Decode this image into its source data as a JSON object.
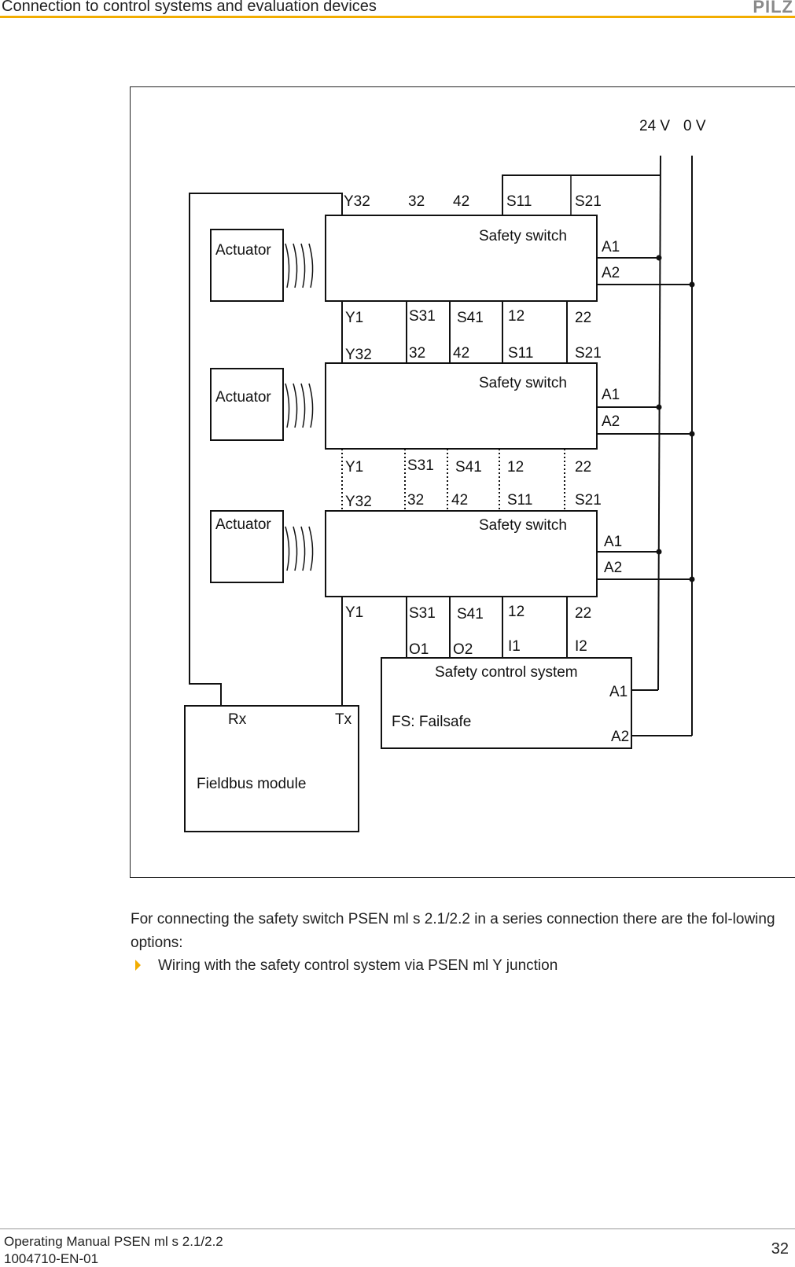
{
  "header": {
    "title": "Connection to control systems and evaluation devices",
    "logo": "PILZ",
    "accent_color": "#f2ad00"
  },
  "diagram": {
    "supply": {
      "v24": "24 V",
      "v0": "0 V"
    },
    "actuator_label": "Actuator",
    "switch_label": "Safety switch",
    "top_terminals": [
      "Y32",
      "32",
      "42",
      "S11",
      "S21"
    ],
    "bottom_terminals": [
      "Y1",
      "S31",
      "S41",
      "12",
      "22"
    ],
    "side_terminals": [
      "A1",
      "A2"
    ],
    "control_system": {
      "label": "Safety control system",
      "inputs_outputs": [
        "O1",
        "O2",
        "I1",
        "I2"
      ],
      "a1": "A1",
      "a2": "A2",
      "note": "FS: Failsafe"
    },
    "fieldbus": {
      "label": "Fieldbus module",
      "rx": "Rx",
      "tx": "Tx"
    }
  },
  "body": {
    "paragraph": "For connecting the safety switch PSEN ml s 2.1/2.2 in a series connection there are the fol-lowing options:",
    "bullets": [
      "Wiring with the safety control system via PSEN ml Y junction"
    ]
  },
  "footer": {
    "line1": "Operating Manual PSEN ml s 2.1/2.2",
    "line2": "1004710-EN-01",
    "page": "32"
  }
}
